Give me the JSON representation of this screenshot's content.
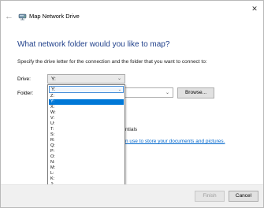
{
  "window": {
    "title": "Map Network Drive",
    "close_glyph": "✕",
    "back_glyph": "←"
  },
  "main": {
    "heading": "What network folder would you like to map?",
    "instruction": "Specify the drive letter for the connection and the folder that you want to connect to:",
    "drive_label": "Drive:",
    "folder_label": "Folder:",
    "drive_value": "Y:",
    "browse_label": "Browse...",
    "credentials_fragment": "ntials",
    "link_fragment": "n use to store your documents and pictures."
  },
  "dropdown": {
    "selected": "Y:",
    "items": [
      "Z:",
      "Y:",
      "X:",
      "W:",
      "V:",
      "U:",
      "T:",
      "S:",
      "R:",
      "Q:",
      "P:",
      "O:",
      "N:",
      "M:",
      "L:",
      "K:",
      "J:",
      "I:",
      "B:",
      "A:"
    ],
    "highlighted_index": 1
  },
  "footer": {
    "finish_label": "Finish",
    "cancel_label": "Cancel"
  },
  "icons": {
    "back": "back-arrow-icon",
    "app": "network-drive-icon",
    "close": "close-icon",
    "chevron": "chevron-down-icon"
  },
  "colors": {
    "heading": "#1f3f8a",
    "link": "#0066cc",
    "selection": "#0078d7"
  }
}
